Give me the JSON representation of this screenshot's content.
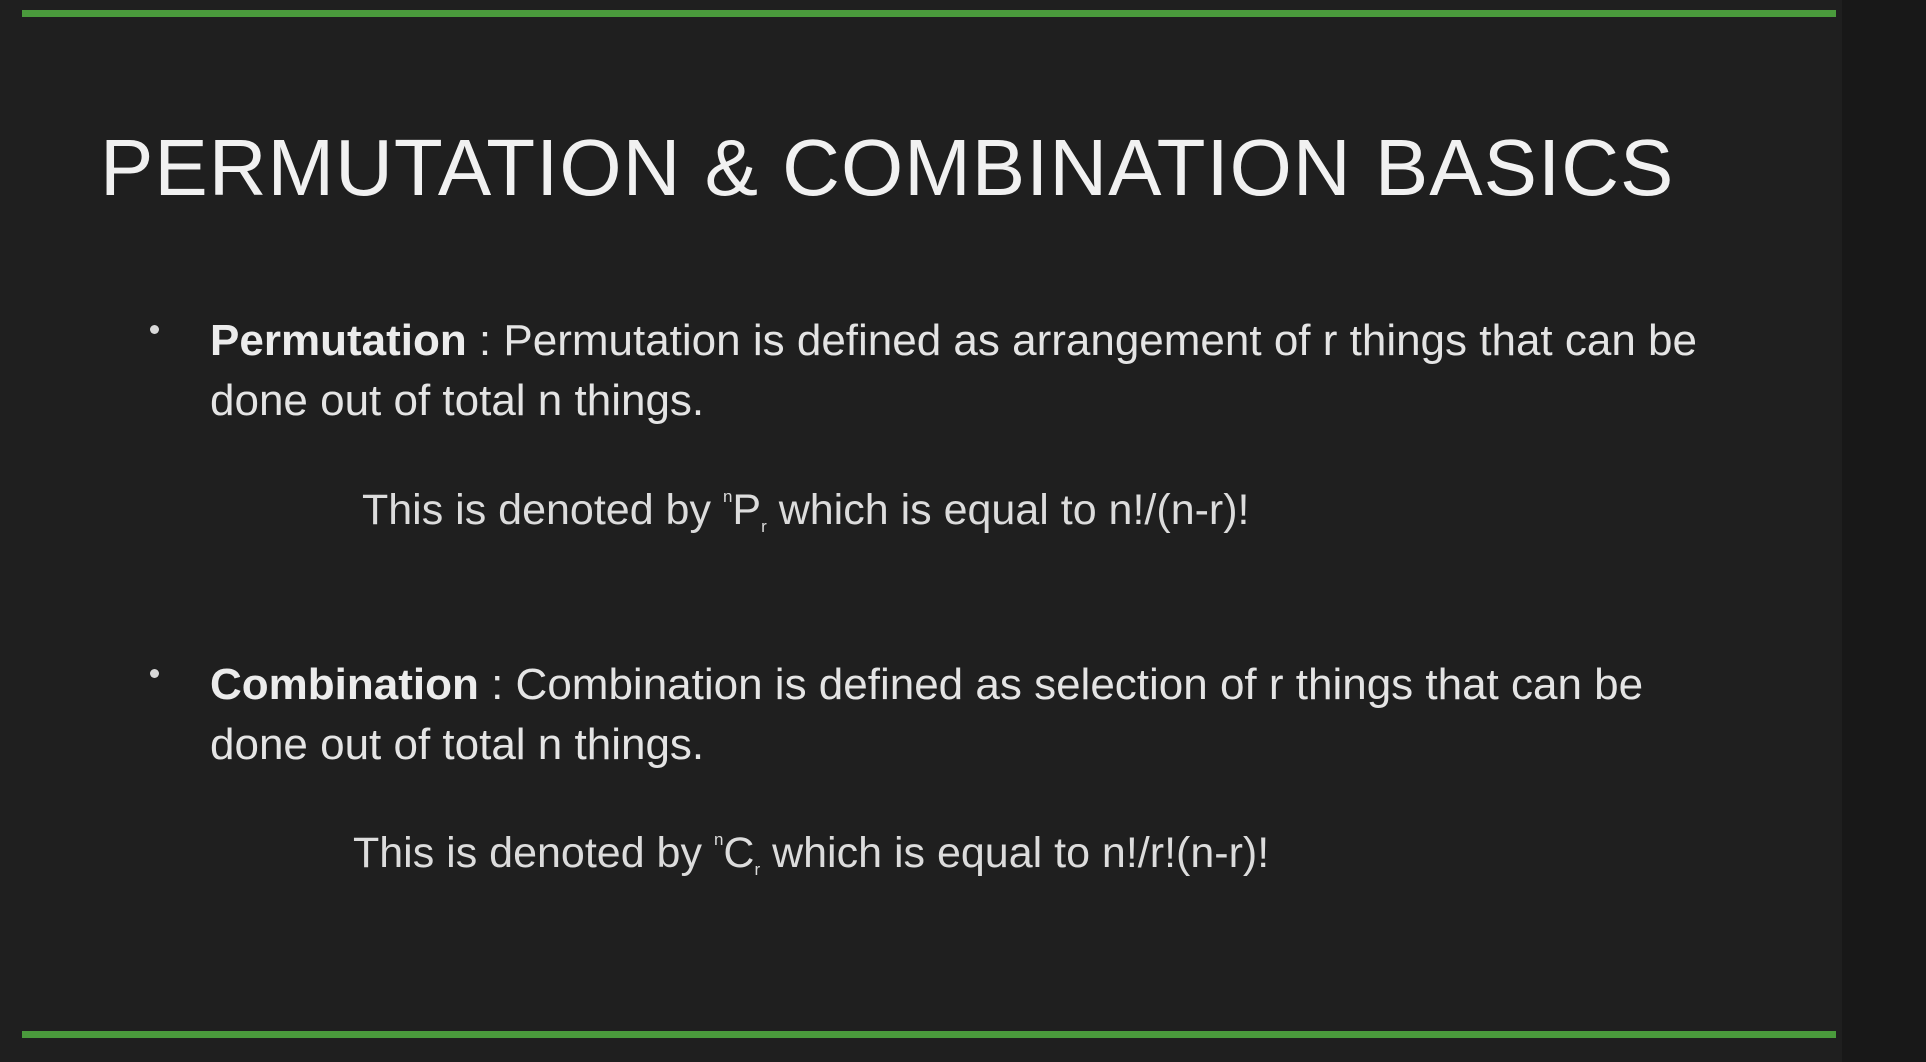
{
  "slide": {
    "title": "PERMUTATION & COMBINATION BASICS",
    "bullets": [
      {
        "term": "Permutation",
        "separator": " : ",
        "definition": "Permutation is defined as arrangement of r things that can be done out of total n things.",
        "formula": {
          "prefix": "This is denoted by ",
          "superscript": "n",
          "symbol": "P",
          "subscript": "r",
          "suffix": " which is equal to n!/(n-r)!"
        }
      },
      {
        "term": "Combination",
        "separator": " : ",
        "definition": "Combination is defined as selection of r things that can be done out of total n things.",
        "formula": {
          "prefix": "This is denoted by ",
          "superscript": "n",
          "symbol": "C",
          "subscript": "r",
          "suffix": " which is equal to n!/r!(n-r)!"
        }
      }
    ]
  },
  "colors": {
    "background": "#1f1f1f",
    "accent_rule": "#4a9a3c",
    "text": "#e4e4e4"
  }
}
